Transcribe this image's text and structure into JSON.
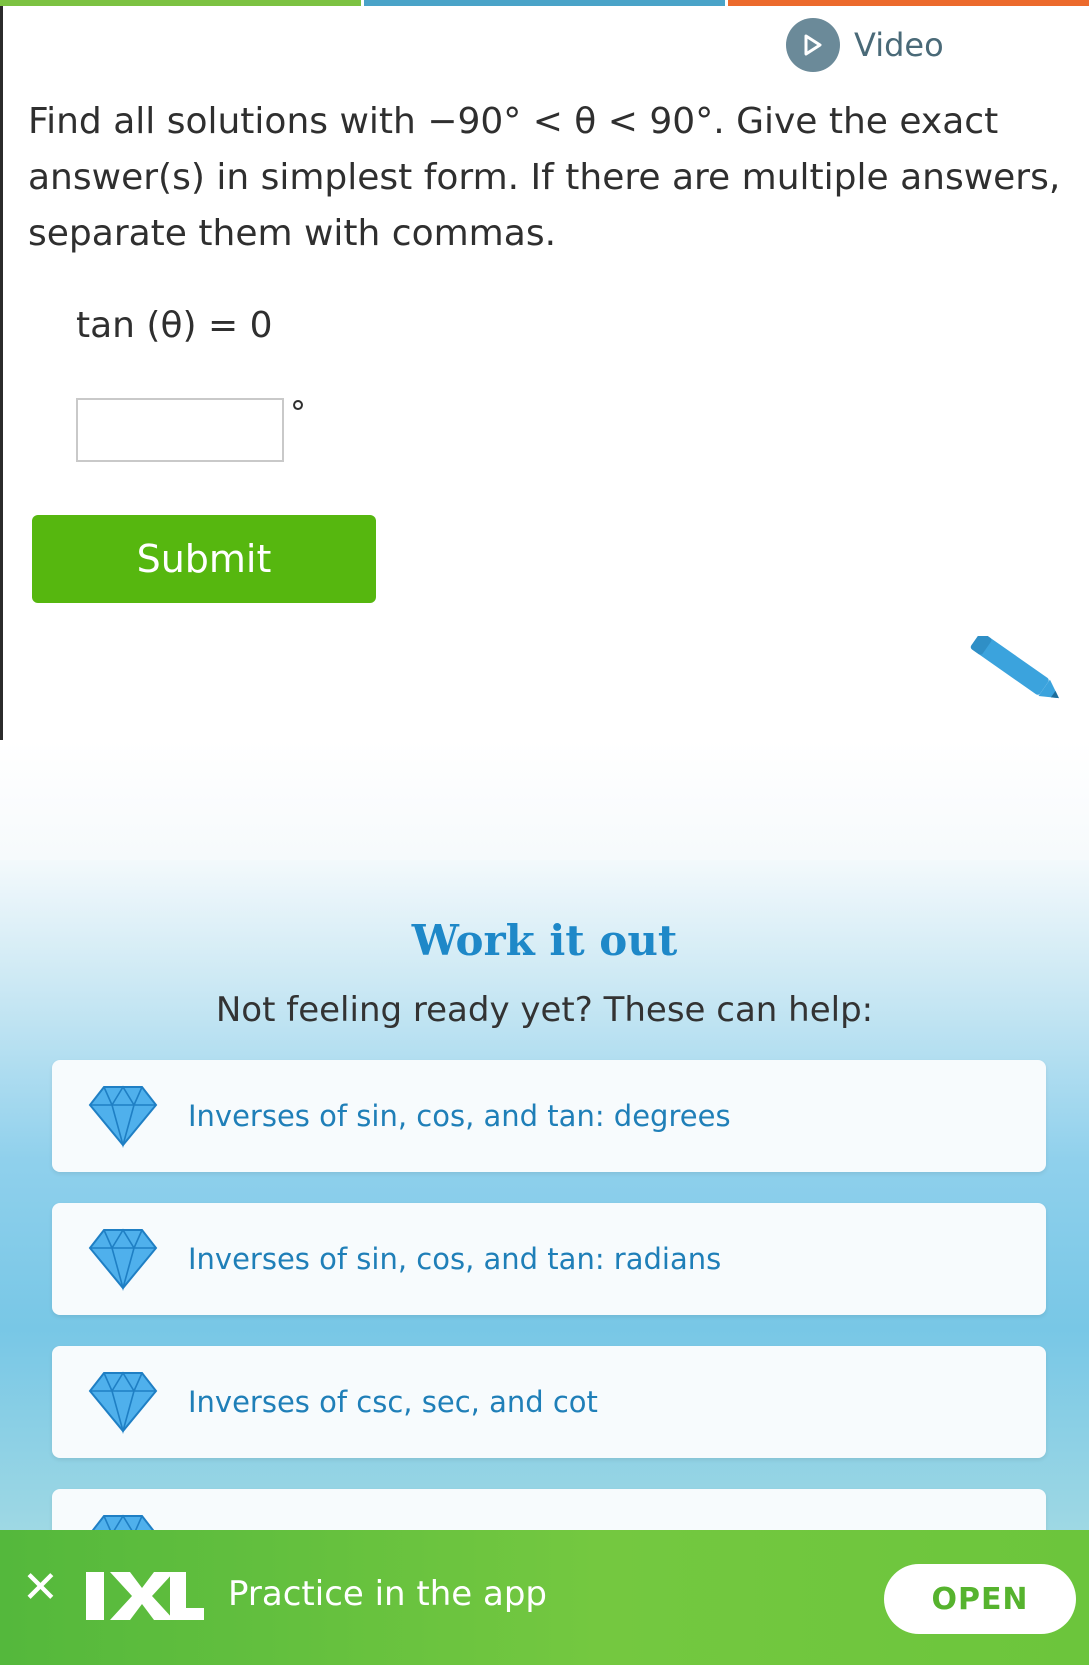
{
  "progress": {
    "segment_colors": [
      "#7cc242",
      "#4aa3c8",
      "#ec6a2c"
    ]
  },
  "video": {
    "label": "Video",
    "icon": "play-icon"
  },
  "question": {
    "text": "Find all solutions with −90° < θ < 90°. Give the exact answer(s) in simplest form. If there are multiple answers, separate them with commas.",
    "equation": "tan (θ) = 0",
    "answer_value": "",
    "unit": "°"
  },
  "submit": {
    "label": "Submit",
    "color": "#56b70f"
  },
  "work_it_out": {
    "title": "Work it out",
    "subtitle": "Not feeling ready yet? These can help:",
    "skills": [
      {
        "label": "Inverses of sin, cos, and tan: degrees",
        "icon": "diamond-icon"
      },
      {
        "label": "Inverses of sin, cos, and tan: radians",
        "icon": "diamond-icon"
      },
      {
        "label": "Inverses of csc, sec, and cot",
        "icon": "diamond-icon"
      },
      {
        "label": "",
        "icon": "diamond-icon"
      }
    ]
  },
  "app_banner": {
    "close_icon": "close-icon",
    "logo_text": "IXL",
    "text": "Practice in the app",
    "open_label": "OPEN"
  }
}
